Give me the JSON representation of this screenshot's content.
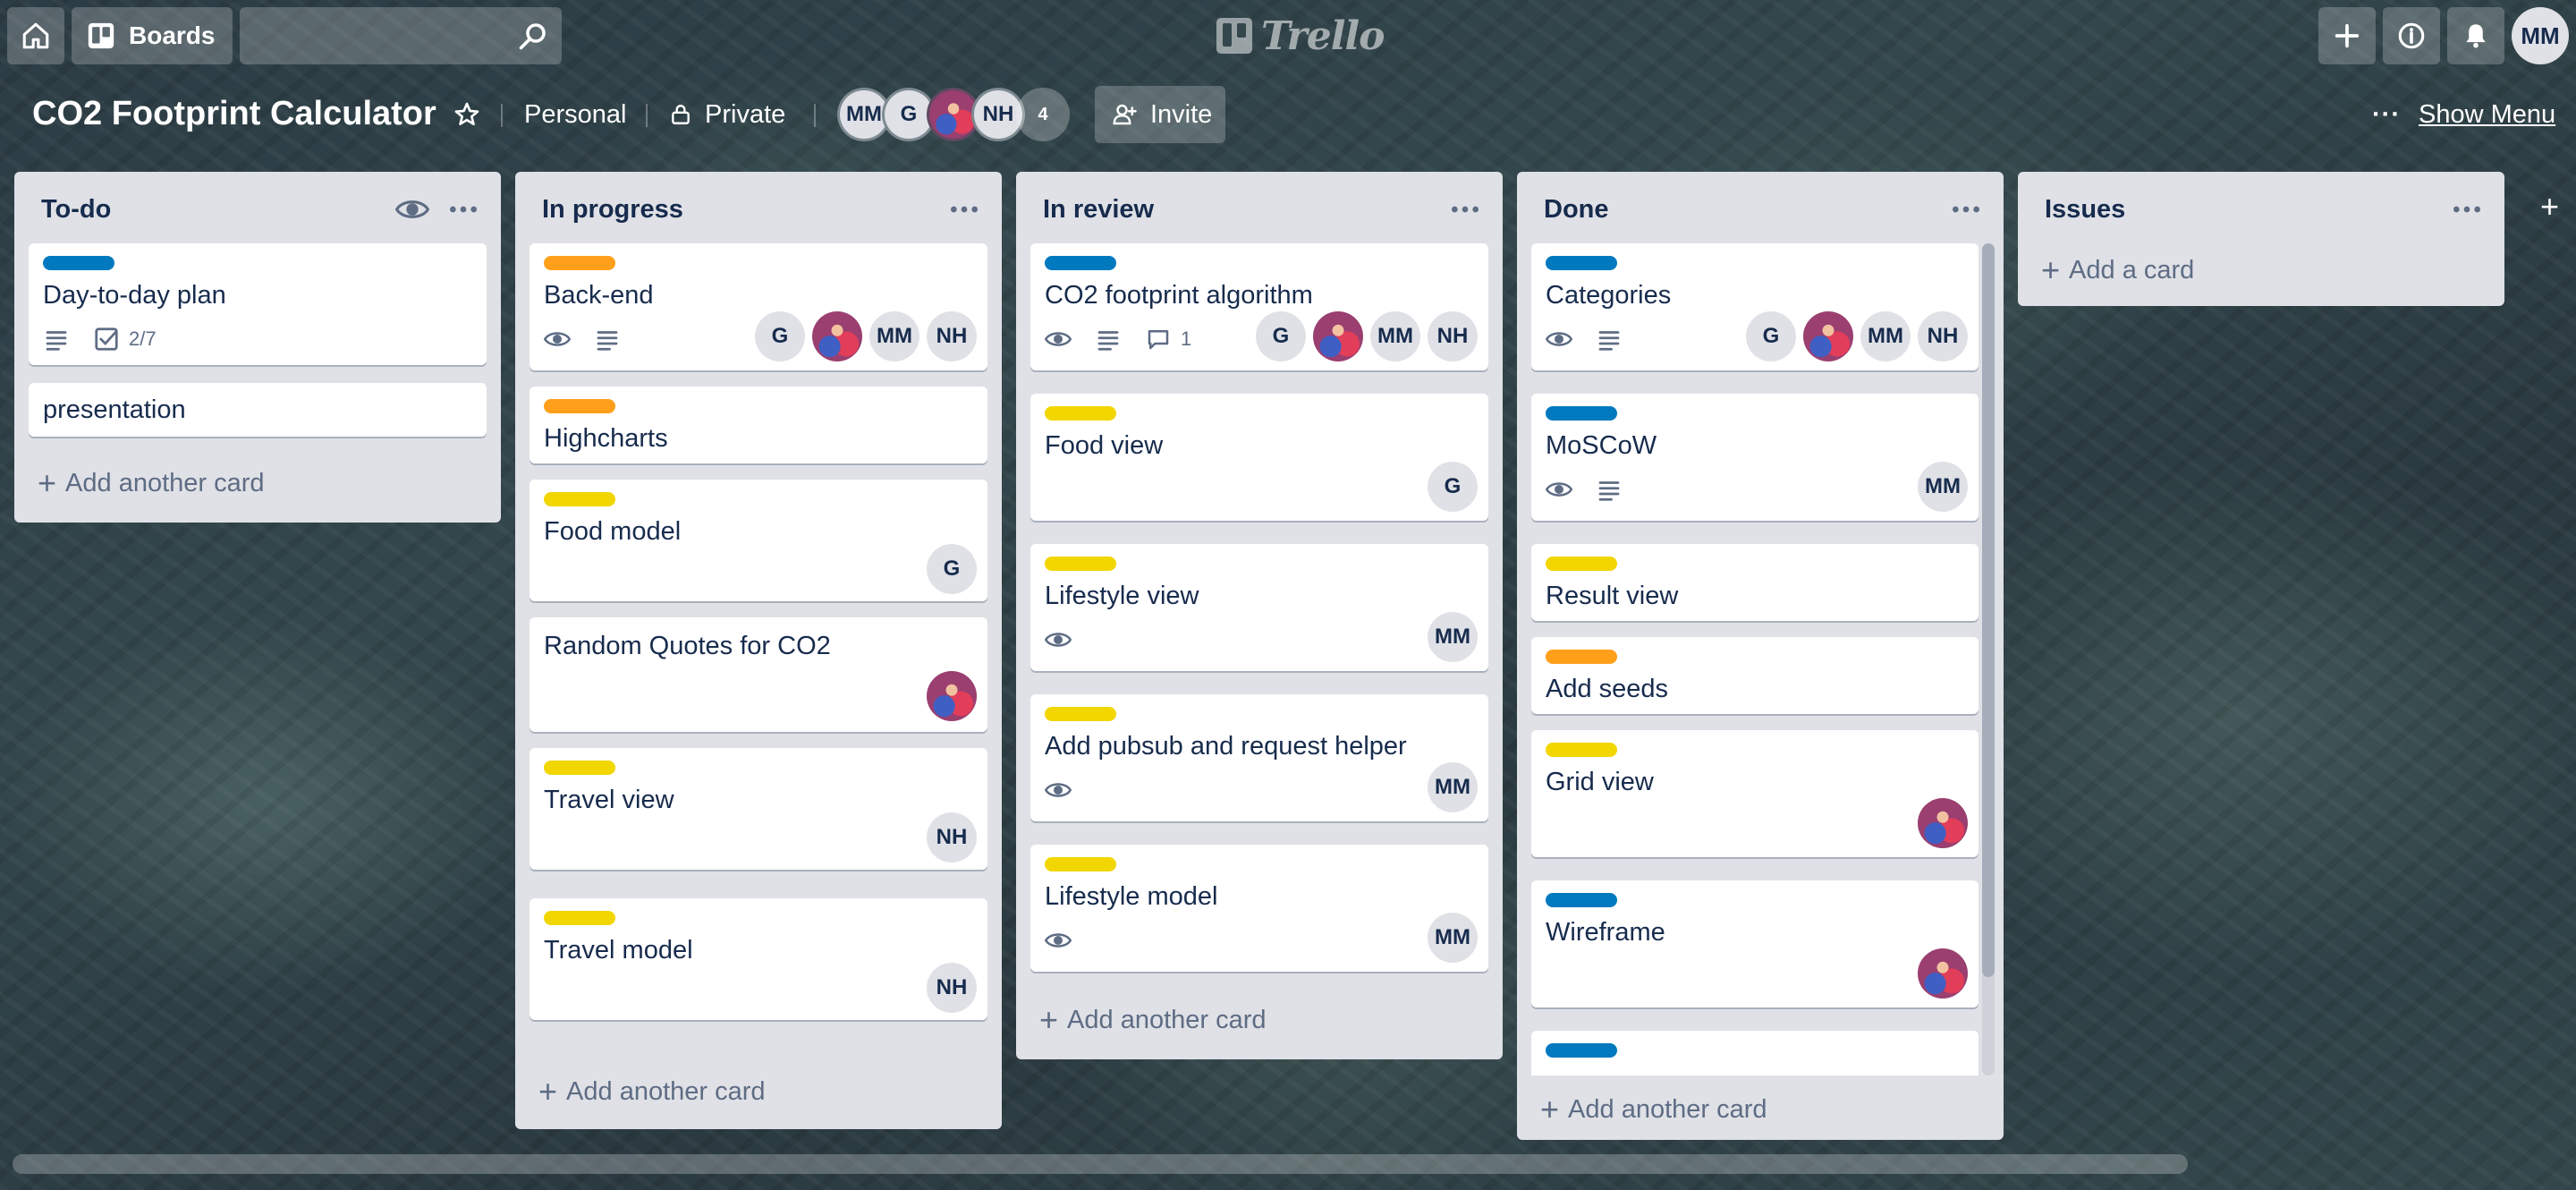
{
  "app": {
    "logo_text": "Trello"
  },
  "topbar": {
    "home_icon": "home-icon",
    "boards_label": "Boards",
    "search_value": "",
    "search_icon": "search-icon",
    "user_initials": "MM"
  },
  "board": {
    "title": "CO2 Footprint Calculator",
    "team": "Personal",
    "visibility": "Private",
    "members": [
      "MM",
      "G",
      "",
      "NH"
    ],
    "member_overflow": "4",
    "invite_label": "Invite",
    "show_menu_label": "Show Menu"
  },
  "lists": [
    {
      "title": "To-do",
      "add_label": "Add another card",
      "cards": [
        {
          "title": "Day-to-day plan",
          "label": "blue",
          "checklist": "2/7"
        },
        {
          "title": "presentation"
        }
      ]
    },
    {
      "title": "In progress",
      "add_label": "Add another card",
      "cards": [
        {
          "title": "Back-end",
          "label": "orange",
          "members": [
            "G",
            "",
            "MM",
            "NH"
          ]
        },
        {
          "title": "Highcharts",
          "label": "orange"
        },
        {
          "title": "Food model",
          "label": "yellow",
          "members": [
            "G"
          ]
        },
        {
          "title": "Random Quotes for CO2",
          "members": [
            ""
          ]
        },
        {
          "title": "Travel view",
          "label": "yellow",
          "members": [
            "NH"
          ]
        },
        {
          "title": "Travel model",
          "label": "yellow",
          "members": [
            "NH"
          ]
        }
      ]
    },
    {
      "title": "In review",
      "add_label": "Add another card",
      "cards": [
        {
          "title": "CO2 footprint algorithm",
          "label": "blue",
          "comments": "1",
          "members": [
            "G",
            "",
            "MM",
            "NH"
          ]
        },
        {
          "title": "Food view",
          "label": "yellow",
          "members": [
            "G"
          ]
        },
        {
          "title": "Lifestyle view",
          "label": "yellow",
          "members": [
            "MM"
          ]
        },
        {
          "title": "Add pubsub and request helper",
          "label": "yellow",
          "members": [
            "MM"
          ]
        },
        {
          "title": "Lifestyle model",
          "label": "yellow",
          "members": [
            "MM"
          ]
        }
      ]
    },
    {
      "title": "Done",
      "add_label": "Add another card",
      "cards": [
        {
          "title": "Categories",
          "label": "blue",
          "members": [
            "G",
            "",
            "MM",
            "NH"
          ]
        },
        {
          "title": "MoSCoW",
          "label": "blue",
          "members": [
            "MM"
          ]
        },
        {
          "title": "Result view",
          "label": "yellow"
        },
        {
          "title": "Add seeds",
          "label": "orange"
        },
        {
          "title": "Grid view",
          "label": "yellow",
          "members": [
            ""
          ]
        },
        {
          "title": "Wireframe",
          "label": "blue",
          "members": [
            ""
          ]
        },
        {
          "title": "",
          "label": "blue"
        }
      ]
    },
    {
      "title": "Issues",
      "add_label": "Add a card",
      "cards": []
    }
  ],
  "colors": {
    "label_blue": "#0079bf",
    "label_orange": "#ff9f1a",
    "label_yellow": "#f2d600",
    "list_bg": "#dfe1e6"
  }
}
